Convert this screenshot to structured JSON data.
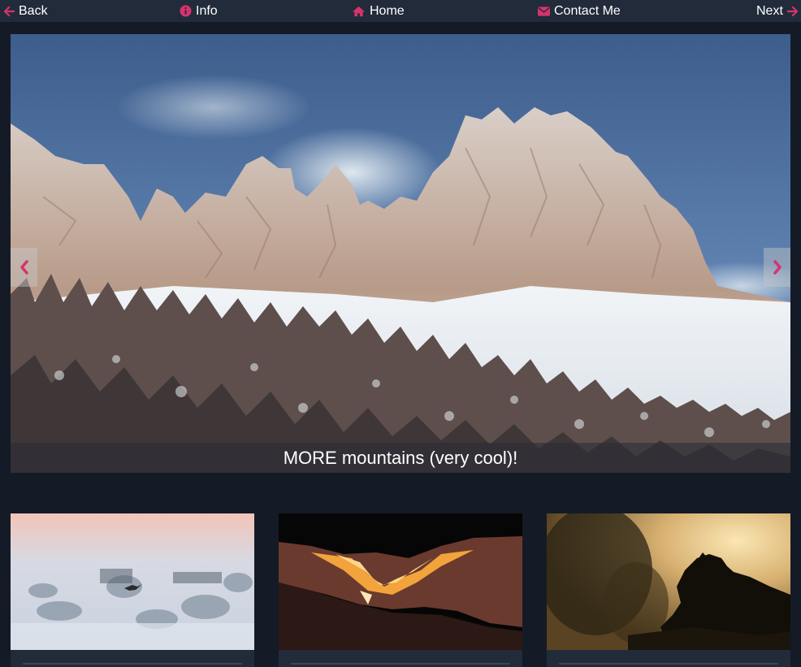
{
  "nav": {
    "back": "Back",
    "info": "Info",
    "home": "Home",
    "contact": "Contact Me",
    "next": "Next"
  },
  "colors": {
    "accent": "#d6336c",
    "nav_bg": "#222b3a",
    "page_bg": "#141b26"
  },
  "icons": {
    "back": "arrow-left-icon",
    "info": "info-circle-icon",
    "home": "home-icon",
    "contact": "envelope-icon",
    "next": "arrow-right-icon",
    "prev_slide": "chevron-left-icon",
    "next_slide": "chevron-right-icon"
  },
  "carousel": {
    "caption": "MORE mountains (very cool)!"
  }
}
